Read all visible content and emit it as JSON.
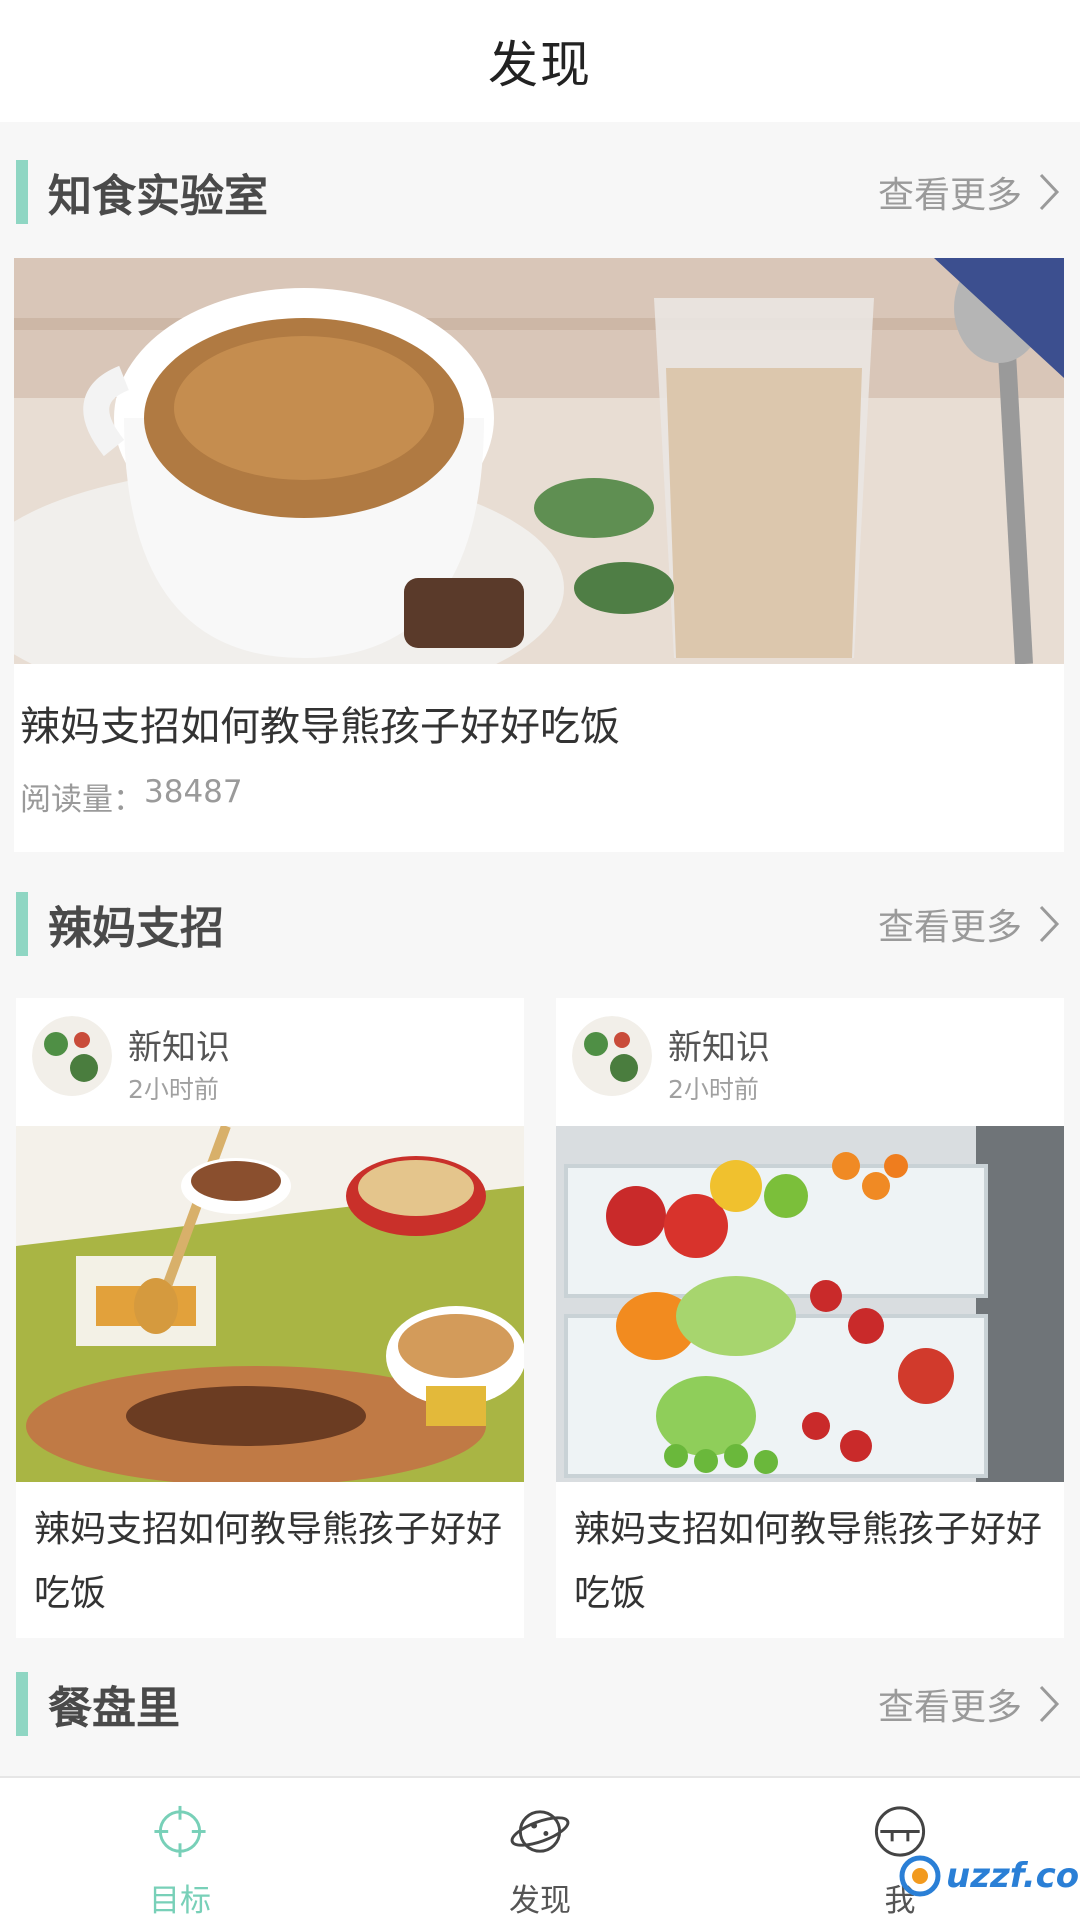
{
  "header": {
    "title": "发现"
  },
  "sections": {
    "lab": {
      "title": "知食实验室",
      "more": "查看更多"
    },
    "tips": {
      "title": "辣妈支招",
      "more": "查看更多"
    },
    "plate": {
      "title": "餐盘里",
      "more": "查看更多"
    }
  },
  "lab_article": {
    "title": "辣妈支招如何教导熊孩子好好吃饭",
    "reads_label": "阅读量：",
    "reads_value": "38487"
  },
  "tip_cards": [
    {
      "author": "新知识",
      "time": "2小时前",
      "title": "辣妈支招如何教导熊孩子好好吃饭"
    },
    {
      "author": "新知识",
      "time": "2小时前",
      "title": "辣妈支招如何教导熊孩子好好吃饭"
    }
  ],
  "bottom_nav": [
    {
      "label": "目标",
      "icon": "target-icon",
      "active": true
    },
    {
      "label": "发现",
      "icon": "planet-icon",
      "active": false
    },
    {
      "label": "我",
      "icon": "profile-icon",
      "active": false
    }
  ],
  "watermark": {
    "text": "uzzf.com"
  },
  "colors": {
    "accent": "#8fd6c3",
    "active_tab": "#78d0b8",
    "muted": "#9a9a9a"
  }
}
